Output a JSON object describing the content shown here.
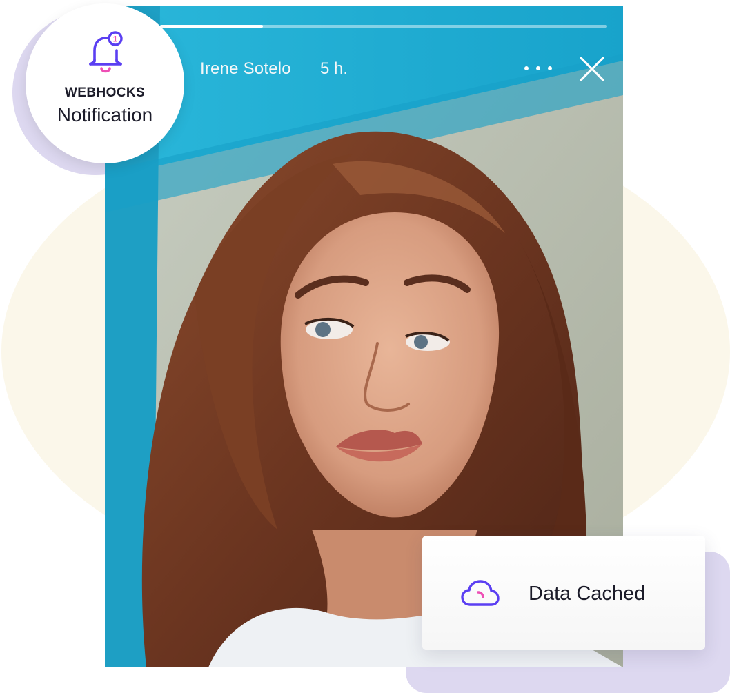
{
  "story": {
    "username": "Irene Sotelo",
    "time_ago": "5 h.",
    "progress_fraction": 0.23,
    "photo_alt": "portrait photo"
  },
  "notification": {
    "title": "WEBHOCKS",
    "subtitle": "Notification",
    "icon": "bell-icon",
    "badge_text": "1"
  },
  "cached": {
    "label": "Data Cached",
    "icon": "cloud-icon"
  },
  "colors": {
    "accent_purple": "#5b3ff2",
    "accent_pink": "#ee4fb5",
    "teal": "#1fb0d6",
    "cream": "#fbf7ea",
    "lavender": "#ddd8f0"
  }
}
